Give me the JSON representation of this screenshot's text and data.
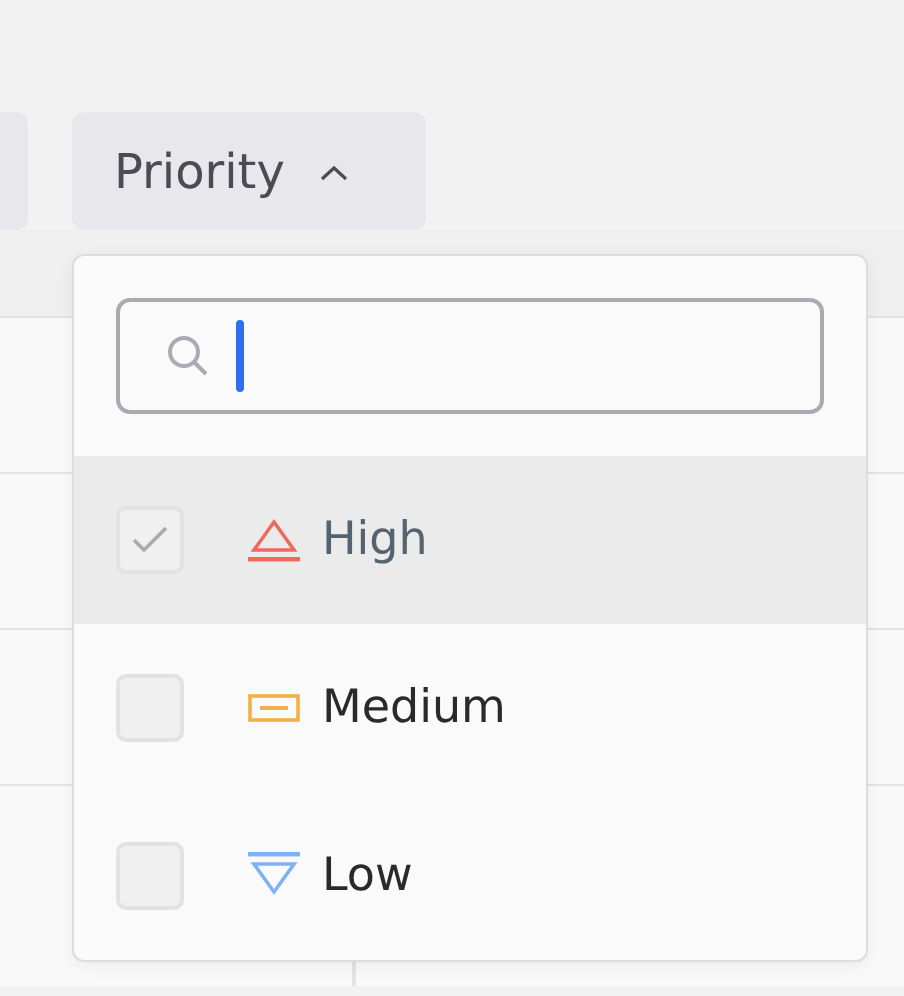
{
  "filter_button": {
    "label": "Priority",
    "expanded": true
  },
  "dropdown": {
    "search": {
      "focused": true
    },
    "options": [
      {
        "label": "High",
        "kind": "high",
        "color": "#ec6a5e",
        "checked": true,
        "highlighted": true
      },
      {
        "label": "Medium",
        "kind": "medium",
        "color": "#f2b04a",
        "checked": false,
        "highlighted": false
      },
      {
        "label": "Low",
        "kind": "low",
        "color": "#7fb2f5",
        "checked": false,
        "highlighted": false
      }
    ]
  }
}
